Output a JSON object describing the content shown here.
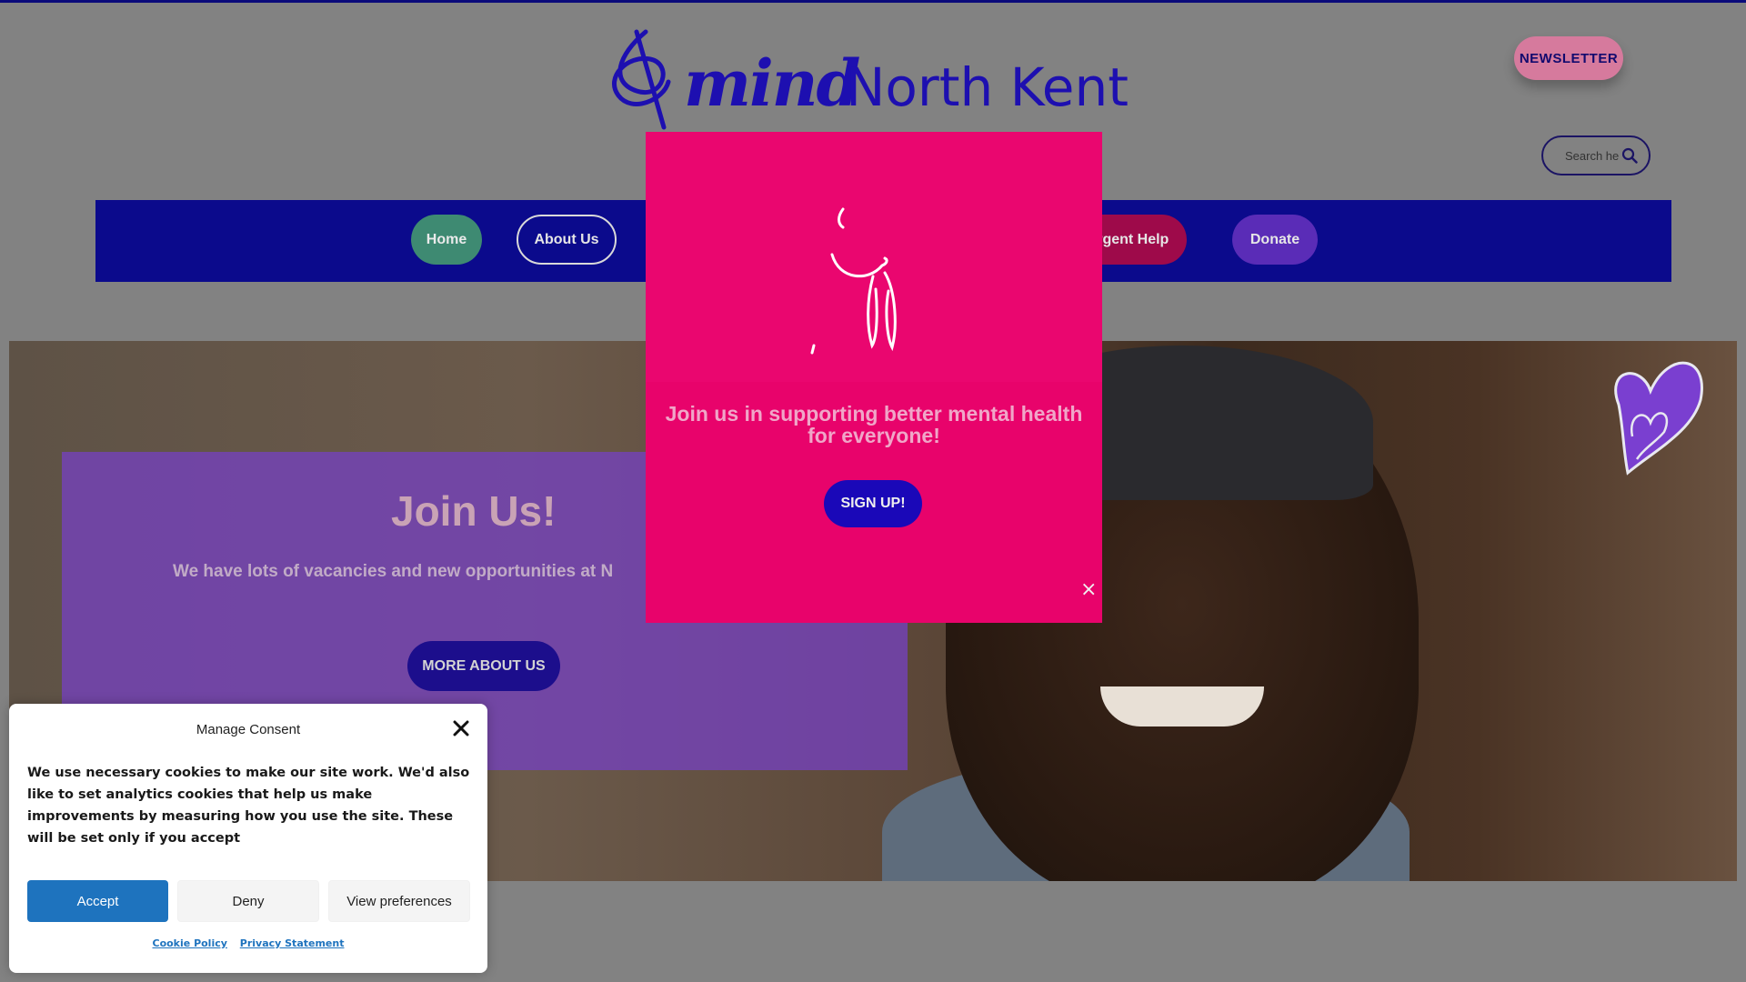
{
  "header": {
    "logo_mind": "mind",
    "logo_place": "North Kent",
    "newsletter_label": "NEWSLETTER",
    "search_placeholder": "Search he"
  },
  "nav": {
    "items": [
      {
        "label": "Home"
      },
      {
        "label": "About Us"
      },
      {
        "label": "Urgent Help"
      },
      {
        "label": "Donate"
      }
    ]
  },
  "hero": {
    "title": "Join Us!",
    "text": "We have lots of vacancies and new opportunities at N",
    "button_label": "MORE ABOUT US"
  },
  "popup": {
    "heading": "Join us in supporting better mental health for everyone!",
    "button_label": "SIGN UP!",
    "close_label": "×"
  },
  "consent": {
    "title": "Manage Consent",
    "text": "We use necessary cookies to make our site work. We'd also like to set analytics cookies that help us make improvements by measuring how you use the site. These will be set only if you accept",
    "accept_label": "Accept",
    "deny_label": "Deny",
    "prefs_label": "View preferences",
    "cookie_policy_label": "Cookie Policy",
    "privacy_label": "Privacy Statement"
  },
  "colors": {
    "nav_bar": "#0b0a8c",
    "popup": "#e8036b",
    "accept": "#1e73be",
    "brand": "#1d0fb0"
  },
  "icons": [
    "mind-logo-icon",
    "search-icon",
    "heart-icon",
    "popup-figure-icon",
    "close-icon"
  ]
}
